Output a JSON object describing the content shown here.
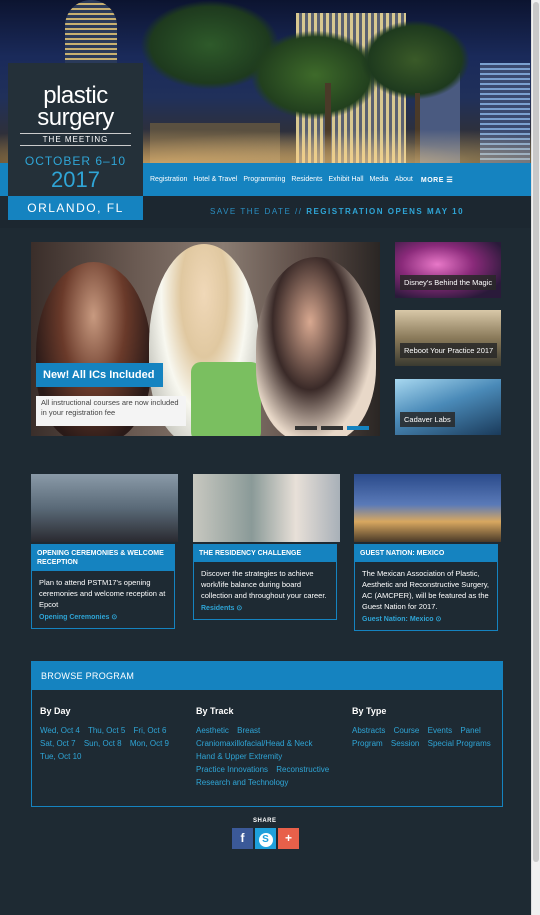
{
  "logo": {
    "line1": "plastic",
    "line2": "surgery",
    "line3": "THE MEETING",
    "dates": "OCTOBER 6–10",
    "year": "2017",
    "city": "ORLANDO, FL"
  },
  "nav": {
    "items": [
      "Registration",
      "Hotel & Travel",
      "Programming",
      "Residents",
      "Exhibit Hall",
      "Media",
      "About"
    ],
    "more": "MORE ☰"
  },
  "save_bar": {
    "part1": "SAVE THE DATE //",
    "part2": "REGISTRATION OPENS MAY 10"
  },
  "slider": {
    "title": "New! All ICs Included",
    "description": "All instructional courses are now included in your registration fee",
    "slide_count": 3,
    "active_slide": 3
  },
  "side_thumbs": [
    {
      "label": "Disney's Behind the Magic"
    },
    {
      "label": "Reboot Your Practice 2017"
    },
    {
      "label": "Cadaver Labs"
    }
  ],
  "cards": [
    {
      "heading": "OPENING CEREMONIES & WELCOME RECEPTION",
      "body": "Plan to attend PSTM17's opening ceremonies and welcome reception at Epcot",
      "link": "Opening Ceremonies ⊙"
    },
    {
      "heading": "THE RESIDENCY CHALLENGE",
      "body": "Discover the strategies to achieve work/life balance during board collection and throughout your career.",
      "link": "Residents ⊙"
    },
    {
      "heading": "GUEST NATION: MEXICO",
      "body": "The Mexican Association of Plastic, Aesthetic and Reconstructive Surgery, AC (AMCPER), will be featured as the Guest Nation for 2017.",
      "link": "Guest Nation: Mexico ⊙"
    }
  ],
  "browse": {
    "title": "BROWSE PROGRAM",
    "by_day": {
      "heading": "By Day",
      "items": [
        "Wed, Oct 4",
        "Thu, Oct 5",
        "Fri, Oct 6",
        "Sat, Oct 7",
        "Sun, Oct 8",
        "Mon, Oct 9",
        "Tue, Oct 10"
      ]
    },
    "by_track": {
      "heading": "By Track",
      "items": [
        "Aesthetic",
        "Breast",
        "Craniomaxillofacial/Head & Neck",
        "Hand & Upper Extremity",
        "Practice Innovations",
        "Reconstructive",
        "Research and Technology"
      ]
    },
    "by_type": {
      "heading": "By Type",
      "items": [
        "Abstracts",
        "Course",
        "Events",
        "Panel",
        "Program",
        "Session",
        "Special Programs"
      ]
    }
  },
  "share": {
    "label": "SHARE",
    "facebook": "f",
    "skype": "S",
    "plus": "+"
  },
  "colors": {
    "accent": "#1583c0",
    "link": "#2fa5d6",
    "background": "#1e2a33"
  }
}
